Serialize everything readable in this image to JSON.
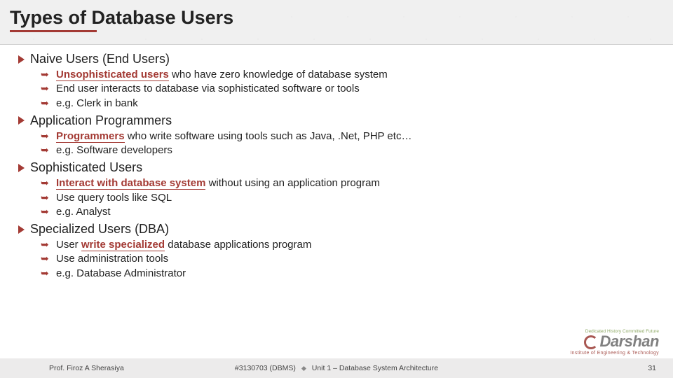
{
  "title": "Types of Database Users",
  "sections": [
    {
      "heading": "Naive Users (End Users)",
      "items": [
        {
          "hl": "Unsophisticated users",
          "rest": " who have zero knowledge of database system"
        },
        {
          "rest": "End user interacts to database via sophisticated software or tools"
        },
        {
          "rest": "e.g. Clerk in bank"
        }
      ]
    },
    {
      "heading": "Application Programmers",
      "items": [
        {
          "hl": "Programmers",
          "rest": " who write software using tools such as Java, .Net, PHP etc…"
        },
        {
          "rest": "e.g. Software developers"
        }
      ]
    },
    {
      "heading": "Sophisticated Users",
      "items": [
        {
          "hl": "Interact with database system",
          "rest": " without using an application program"
        },
        {
          "rest": "Use query tools like SQL"
        },
        {
          "rest": "e.g. Analyst"
        }
      ]
    },
    {
      "heading": "Specialized Users (DBA)",
      "items": [
        {
          "pre": "User ",
          "hl": "write specialized",
          "rest": " database applications program"
        },
        {
          "rest": "Use administration tools"
        },
        {
          "rest": "e.g. Database Administrator"
        }
      ]
    }
  ],
  "footer": {
    "author": "Prof. Firoz A Sherasiya",
    "code": "#3130703 (DBMS)",
    "unit": "Unit 1 – Database System Architecture",
    "page": "31"
  },
  "logo": {
    "tagline": "Dedicated History Committed Future",
    "brand": "Darshan",
    "sub": "Institute of Engineering & Technology"
  }
}
